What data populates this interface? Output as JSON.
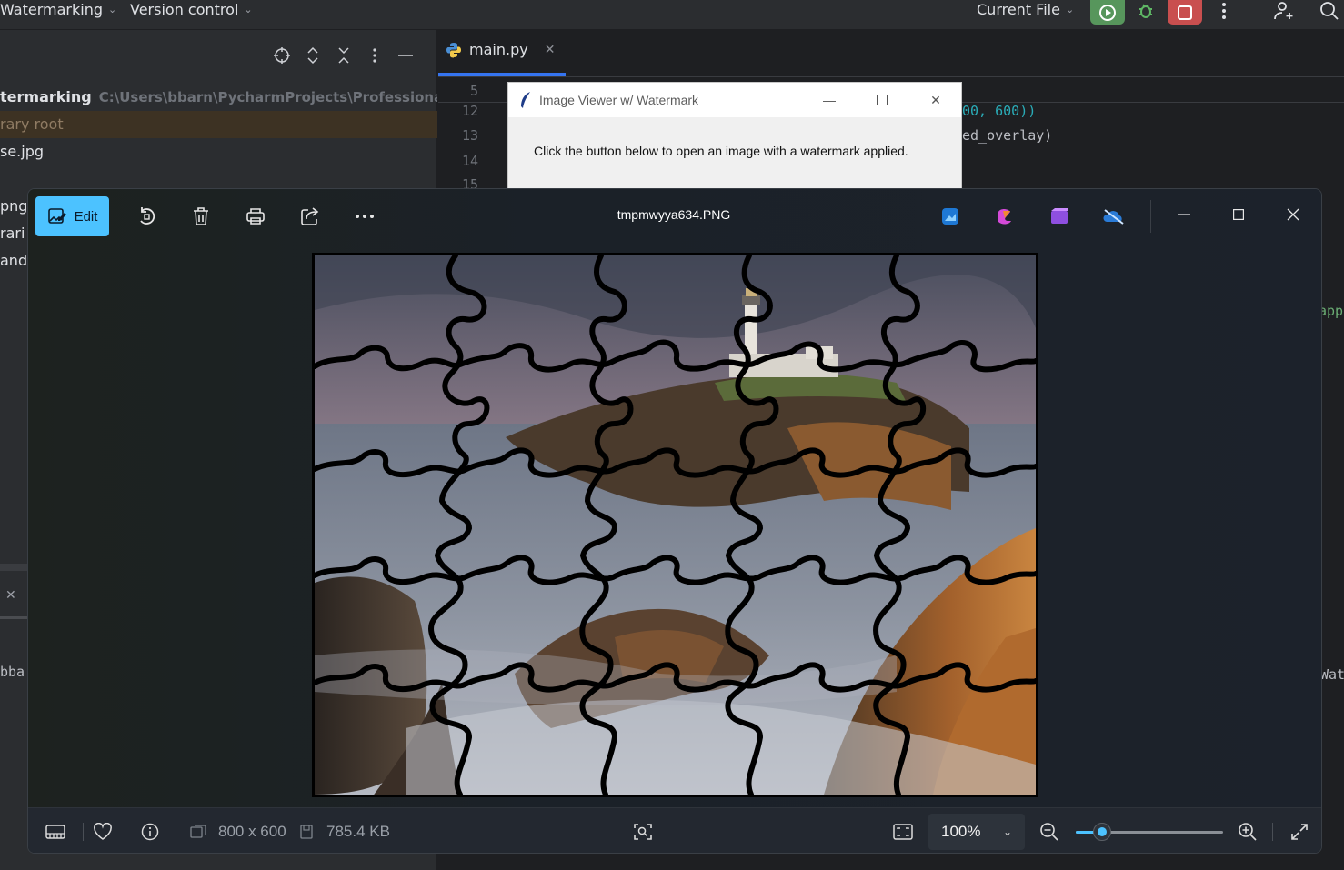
{
  "ide": {
    "menu_project": "Watermarking",
    "menu_vcs": "Version control",
    "run_config": "Current File",
    "project_tree": [
      {
        "name": "termarking",
        "path": "C:\\Users\\bbarn\\PycharmProjects\\ProfessionalPro"
      },
      {
        "name": "rary root",
        "path": ""
      },
      {
        "name": "se.jpg",
        "path": ""
      },
      {
        "name": "png",
        "path": ""
      },
      {
        "name": "rari",
        "path": ""
      },
      {
        "name": "and",
        "path": ""
      }
    ],
    "bottom_fragment": "bba",
    "editor_tab": "main.py",
    "line_numbers": [
      "5",
      "12",
      "13",
      "14",
      "15"
    ],
    "code_line_12": "00, 600))",
    "code_line_13": "ed_overlay)",
    "right_fragment_1": "app",
    "right_fragment_2": "Wat"
  },
  "dialog": {
    "title": "Image Viewer w/ Watermark",
    "message": "Click the button below to open an image with a watermark applied."
  },
  "viewer": {
    "edit_label": "Edit",
    "filename": "tmpmwyya634.PNG",
    "dimensions": "800 x 600",
    "file_size": "785.4 KB",
    "zoom": "100%",
    "zoom_slider_fraction": 0.18
  },
  "colors": {
    "accent": "#4cc2ff",
    "ide_run_green": "#57965c",
    "ide_stop_red": "#c94f4f"
  }
}
